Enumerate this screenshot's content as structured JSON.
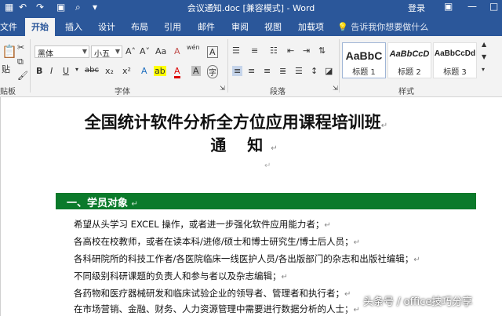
{
  "titlebar": {
    "doc_title": "会议通知.doc [兼容模式] - Word",
    "login": "登录",
    "restore_icon": "▣",
    "minimize_icon": "—",
    "maximize_icon": "□",
    "close_icon": "✕"
  },
  "tabs": [
    "文件",
    "开始",
    "插入",
    "设计",
    "布局",
    "引用",
    "邮件",
    "审阅",
    "视图",
    "加载项"
  ],
  "tell_me": "告诉我你想要做什么",
  "ribbon": {
    "paste_label": "贴",
    "clipboard_label": "贴板",
    "font_name": "黑体",
    "font_size": "小五",
    "font_group_label": "字体",
    "paragraph_group_label": "段落",
    "styles_group_label": "样式",
    "bold": "B",
    "italic": "I",
    "underline": "U",
    "strike": "abc",
    "sub": "x₂",
    "sup": "x²",
    "grow_font": "A˄",
    "shrink_font": "A˅",
    "change_case": "Aa",
    "clear_format": "A",
    "phonetic": "wén",
    "char_border": "A",
    "highlight": "ab",
    "font_color": "A",
    "char_shade": "A",
    "enclose": "字",
    "styles": [
      {
        "sample": "AaBbC",
        "name": "标题 1"
      },
      {
        "sample": "AaBbCcD",
        "name": "标题 2"
      },
      {
        "sample": "AaBbCcDd",
        "name": "标题 3"
      }
    ]
  },
  "document": {
    "title_line1": "全国统计软件分析全方位应用课程培训班",
    "title_line2": "通 知",
    "para_mark": "↵",
    "section1": "一、学员对象",
    "lines": [
      "希望从头学习 EXCEL 操作，或者进一步强化软件应用能力者；",
      "各高校在校教师，或者在读本科/进修/硕士和博士研究生/博士后人员；",
      "各科研院所的科技工作者/各医院临床一线医护人员/各出版部门的杂志和出版社编辑；",
      "不同级别科研课题的负责人和参与者以及杂志编辑；",
      "各药物和医疗器械研发和临床试验企业的领导者、管理者和执行者；",
      "在市场营销、金融、财务、人力资源管理中需要进行数据分析的人士；"
    ]
  },
  "watermark": "头条号 / office技巧分享",
  "colors": {
    "word_blue": "#2b579a",
    "section_green": "#0b7a2b"
  }
}
